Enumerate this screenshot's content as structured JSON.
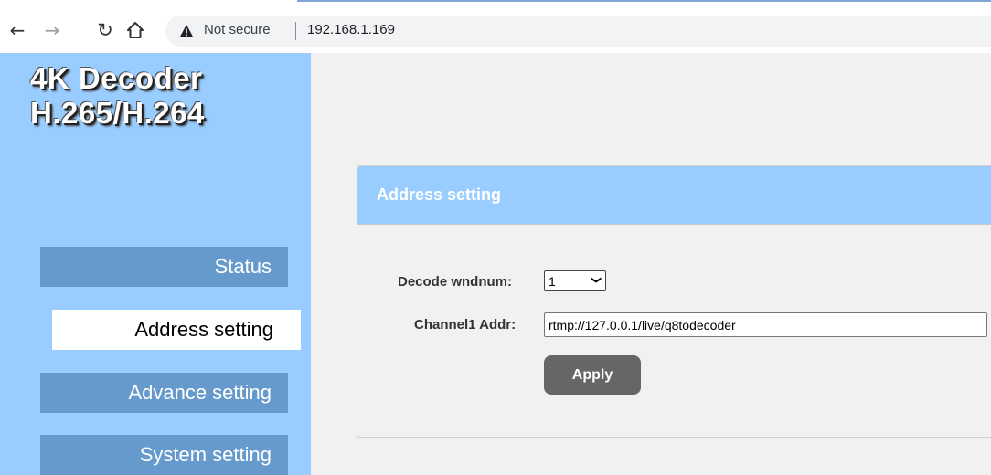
{
  "browser": {
    "back_icon": "arrow-left-icon",
    "forward_icon": "arrow-right-icon",
    "reload_icon": "reload-icon",
    "home_icon": "home-icon",
    "security_label": "Not secure",
    "url": "192.168.1.169"
  },
  "sidebar": {
    "brand_line1": "4K Decoder",
    "brand_line2": "H.265/H.264",
    "items": [
      {
        "label": "Status",
        "active": false
      },
      {
        "label": "Address setting",
        "active": true
      },
      {
        "label": "Advance setting",
        "active": false
      },
      {
        "label": "System setting",
        "active": false
      }
    ]
  },
  "panel": {
    "title": "Address setting",
    "decode_wndnum_label": "Decode wndnum:",
    "decode_wndnum_value": "1",
    "channel1_label": "Channel1 Addr:",
    "channel1_value": "rtmp://127.0.0.1/live/q8todecoder",
    "apply_label": "Apply"
  },
  "colors": {
    "sidebar_bg": "#99ccff",
    "nav_button_bg": "#6699cc",
    "panel_header_bg": "#99ccff",
    "apply_bg": "#666666"
  }
}
